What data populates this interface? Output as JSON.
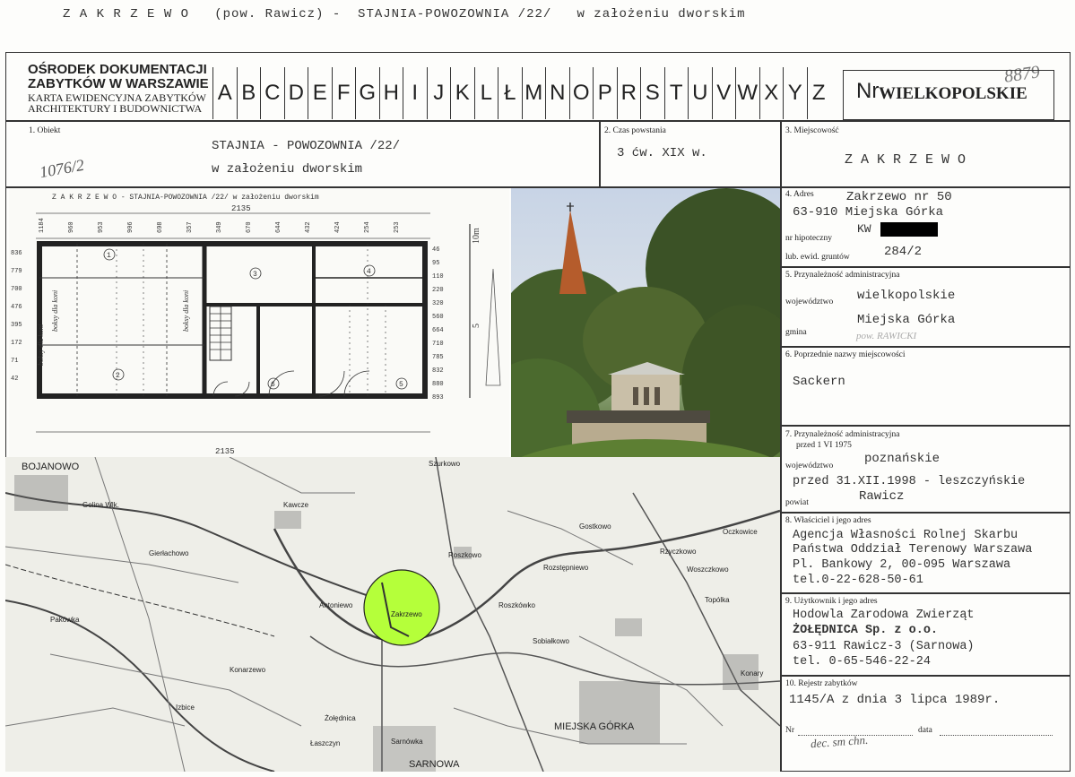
{
  "header": {
    "title_line": "Z A K R Z E W O   (pow. Rawicz) -  STAJNIA-POWOZOWNIA /22/   w założeniu dworskim",
    "org_line1": "OŚRODEK DOKUMENTACJI",
    "org_line2": "ZABYTKÓW W WARSZAWIE",
    "org_line3": "KARTA EWIDENCYJNA ZABYTKÓW",
    "org_line4": "ARCHITEKTURY I BUDOWNICTWA",
    "letters": [
      "A",
      "B",
      "C",
      "D",
      "E",
      "F",
      "G",
      "H",
      "I",
      "J",
      "K",
      "L",
      "Ł",
      "M",
      "N",
      "O",
      "P",
      "R",
      "S",
      "T",
      "U",
      "V",
      "W",
      "X",
      "Y",
      "Z"
    ],
    "nr_label": "Nr",
    "province_stamp": "WIELKOPOLSKIE",
    "handwritten_number": "8879"
  },
  "obiekt": {
    "label": "1. Obiekt",
    "line1": "STAJNIA - POWOZOWNIA /22/",
    "line2": "w założeniu dworskim",
    "inventory_no": "1076/2"
  },
  "czas": {
    "label": "2. Czas powstania",
    "value": "3 ćw. XIX w."
  },
  "miejscowosc": {
    "label": "3. Miejscowość",
    "value": "Z A K R Z E W O"
  },
  "adres": {
    "label": "4. Adres",
    "line1": "Zakrzewo nr 50",
    "line2": "63-910 Miejska Górka",
    "kw": "KW",
    "hipoteczny_label": "nr hipoteczny",
    "ewid_label": "lub. ewid. gruntów",
    "ewid_value": "284/2"
  },
  "przynaleznosc": {
    "label": "5. Przynależność administracyjna",
    "woj_label": "województwo",
    "woj_value": "wielkopolskie",
    "gmina_label": "gmina",
    "gmina_value": "Miejska Górka",
    "powiat_note": "pow. RAWICKI"
  },
  "poprzednie": {
    "label": "6. Poprzednie nazwy miejscowości",
    "value": "Sackern"
  },
  "przynaleznosc1975": {
    "label": "7. Przynależność administracyjna",
    "sub": "przed 1 VI 1975",
    "woj_label": "województwo",
    "woj_value": "poznańskie",
    "line2": "przed 31.XII.1998 - leszczyńskie",
    "powiat_label": "powiat",
    "powiat_value": "Rawicz"
  },
  "wlasciciel": {
    "label": "8. Właściciel i jego adres",
    "l1": "Agencja Własności Rolnej Skarbu",
    "l2": "Państwa Oddział Terenowy Warszawa",
    "l3": "Pl. Bankowy 2, 00-095 Warszawa",
    "l4": "tel.0-22-628-50-61"
  },
  "uzytkownik": {
    "label": "9. Użytkownik i jego adres",
    "l1": "Hodowla Zarodowa Zwierząt",
    "l2": "ŻOŁĘDNICA Sp. z o.o.",
    "l3": "63-911 Rawicz-3 (Sarnowa)",
    "l4": "tel. 0-65-546-22-24"
  },
  "rejestr": {
    "label": "10. Rejestr zabytków",
    "value": "1145/A z dnia 3 lipca 1989r.",
    "nr_label": "Nr",
    "data_label": "data",
    "note": "dec. sm chn."
  },
  "plan": {
    "caption": "Z A K R Z E W O  - STAJNIA-POWOZOWNIA /22/ w założeniu dworskim",
    "total_dim": "2135",
    "total_dim_bottom": "2135",
    "scale": "10m",
    "scale_mid": "5",
    "rooms": [
      "1",
      "2",
      "3",
      "4",
      "5",
      "6"
    ],
    "top_dims": [
      "1184",
      "960",
      "953",
      "906",
      "698",
      "357",
      "349",
      "670",
      "644",
      "432",
      "424",
      "254",
      "253"
    ],
    "right_dims": [
      "46",
      "95",
      "110",
      "220",
      "320",
      "560",
      "664",
      "710",
      "785",
      "832",
      "880",
      "893"
    ],
    "left_dims": [
      "836",
      "779",
      "700",
      "476",
      "395",
      "172",
      "71",
      "42"
    ],
    "labels": [
      "boksy dla koni",
      "boksy dla koni",
      "boksy dla koni"
    ]
  },
  "map": {
    "places": [
      "BOJANOWO",
      "Golina Wlk.",
      "Szurkowo",
      "Kawcze",
      "Gierłachowo",
      "Pakówka",
      "Konarzewo",
      "Izbice",
      "Łaszczyn",
      "Żołędnica",
      "Sarnówka",
      "Roszkowo",
      "Rozstępniewo",
      "Roszkówko",
      "Sobiałkowo",
      "Woszczkowo",
      "Oczkowice",
      "Topólka",
      "Konary",
      "MIEJSKA GÓRKA",
      "SARNOWA",
      "Zakrzewo",
      "Rzyczkowo",
      "Gostkowo",
      "Antoniewo"
    ],
    "highlight": "Zakrzewo",
    "highlight_color": "#b5ff3a"
  }
}
